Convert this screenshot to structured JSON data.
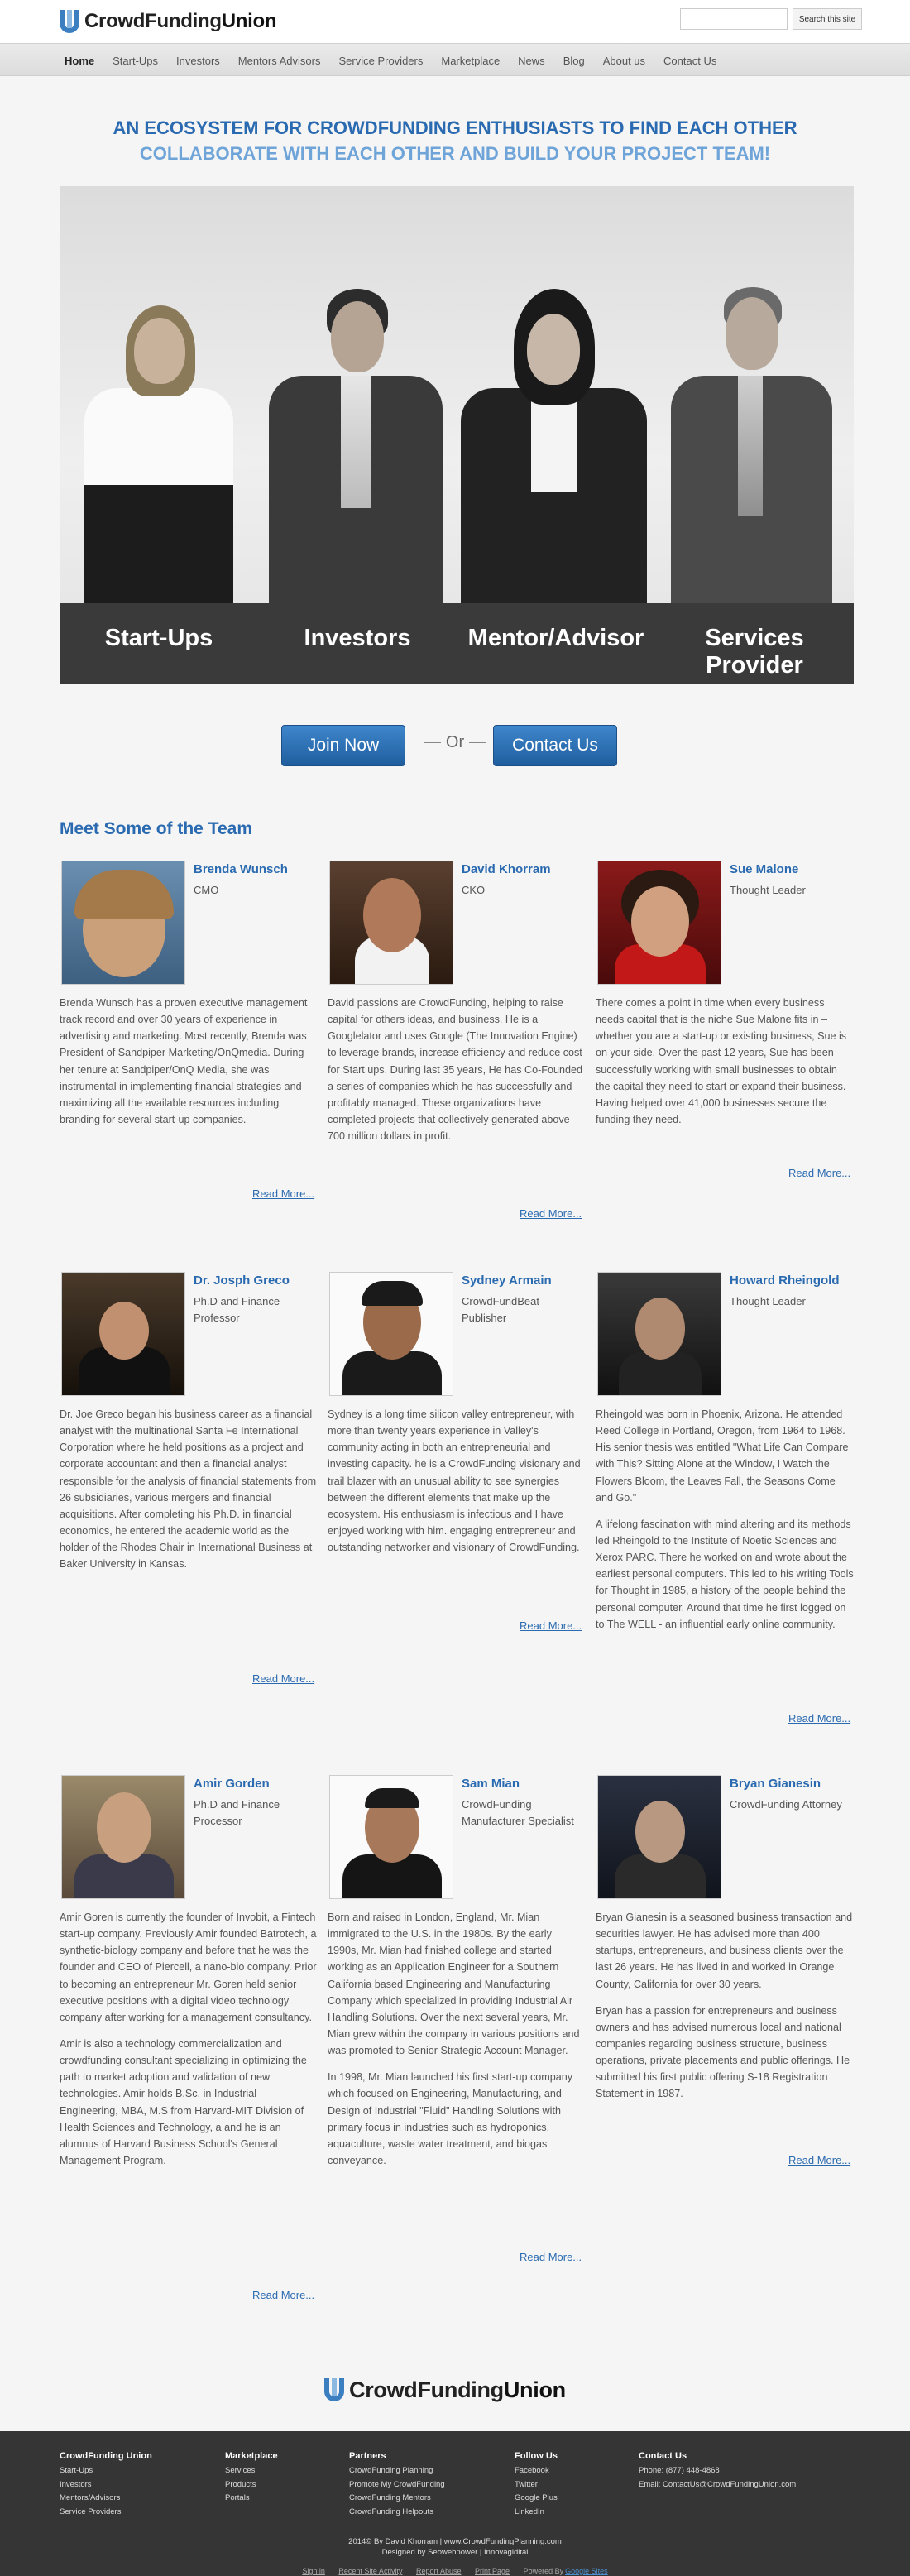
{
  "header": {
    "logo_prefix": "CrowdFunding",
    "logo_bold": "Union",
    "search_placeholder": "",
    "search_button": "Search this site"
  },
  "nav": [
    "Home",
    "Start-Ups",
    "Investors",
    "Mentors Advisors",
    "Service Providers",
    "Marketplace",
    "News",
    "Blog",
    "About us",
    "Contact Us"
  ],
  "hero": {
    "tagline1": "AN ECOSYSTEM FOR CROWDFUNDING ENTHUSIASTS TO FIND EACH OTHER",
    "tagline2": "COLLABORATE WITH EACH OTHER AND BUILD YOUR PROJECT TEAM!",
    "labels": [
      "Start-Ups",
      "Investors",
      "Mentor/Advisor",
      "Services Provider"
    ]
  },
  "cta": {
    "join": "Join Now",
    "or": "Or",
    "contact": "Contact Us"
  },
  "team": {
    "title": "Meet Some of the Team",
    "more_label": "Read More...",
    "members": [
      {
        "name": "Brenda Wunsch",
        "role": "CMO",
        "bio": [
          "Brenda Wunsch has a proven executive management track record and over 30 years of experience in advertising and marketing. Most recently, Brenda was President of Sandpiper Marketing/OnQmedia. During her tenure at Sandpiper/OnQ Media, she was instrumental in implementing financial strategies and maximizing all the available resources including branding for several start-up companies."
        ]
      },
      {
        "name": "David Khorram",
        "role": "CKO",
        "bio": [
          "David passions are CrowdFunding, helping to raise capital for others ideas, and business. He is a Googlelator and uses Google (The Innovation Engine) to leverage brands, increase efficiency and reduce cost for Start ups. During last 35 years, He has Co-Founded a series of companies which he has successfully and profitably managed. These organizations have completed projects that collectively generated above 700 million dollars in profit."
        ]
      },
      {
        "name": "Sue Malone",
        "role": "Thought Leader",
        "bio": [
          "There comes a point in time when every business needs capital that is the niche Sue Malone fits in – whether you are a start-up or existing business, Sue is on your side. Over the past 12 years, Sue has been successfully working with small businesses to obtain the capital they need to start or expand their business. Having helped over 41,000 businesses secure the funding they need."
        ]
      },
      {
        "name": "Dr. Josph Greco",
        "role": "Ph.D and Finance Professor",
        "bio": [
          "Dr. Joe Greco began his business career as a financial analyst with the multinational Santa Fe International Corporation where he held positions as a project and corporate accountant and then a financial analyst responsible for the analysis of financial statements from 26 subsidiaries, various mergers and financial acquisitions. After completing his Ph.D. in financial economics, he entered the academic world as the holder of the Rhodes Chair in International Business at Baker University in Kansas."
        ]
      },
      {
        "name": "Sydney Armain",
        "role": "CrowdFundBeat Publisher",
        "bio": [
          "Sydney is a long time silicon valley entrepreneur, with more than twenty years experience in Valley's community acting in both an entrepreneurial and investing capacity. he is a CrowdFunding visionary and trail blazer with an unusual ability to see synergies between the different elements that make up the ecosystem. His enthusiasm is infectious and I have enjoyed working with him. engaging entrepreneur and outstanding networker and visionary of CrowdFunding."
        ]
      },
      {
        "name": "Howard Rheingold",
        "role": "Thought Leader",
        "bio": [
          "Rheingold was born in Phoenix, Arizona. He attended Reed College in Portland, Oregon, from 1964 to 1968. His senior thesis was entitled \"What Life Can Compare with This? Sitting Alone at the Window, I Watch the Flowers Bloom, the Leaves Fall, the Seasons Come and Go.\"",
          "A lifelong fascination with mind altering and its methods led Rheingold to the Institute of Noetic Sciences and Xerox PARC. There he worked on and wrote about the earliest personal computers. This led to his writing Tools for Thought in 1985, a history of the people behind the personal computer. Around that time he first logged on to The WELL - an influential early online community."
        ]
      },
      {
        "name": "Amir Gorden",
        "role": "Ph.D and Finance Processor",
        "bio": [
          "Amir Goren is currently the founder of Invobit, a Fintech start-up company. Previously Amir founded Batrotech, a synthetic-biology company and before that he was the founder and CEO of Piercell, a nano-bio company. Prior to becoming an entrepreneur Mr. Goren held senior executive positions with a digital video technology company after working for a management consultancy.",
          "Amir is also a technology commercialization and crowdfunding consultant specializing in optimizing the path to market adoption and validation of new technologies. Amir holds B.Sc. in Industrial Engineering, MBA, M.S from Harvard-MIT Division of Health Sciences and Technology, a and he is an alumnus of Harvard Business School's General Management Program."
        ]
      },
      {
        "name": "Sam Mian",
        "role": "CrowdFunding Manufacturer Specialist",
        "bio": [
          "Born and raised in London, England, Mr. Mian immigrated to the U.S. in the 1980s. By the early 1990s, Mr. Mian had finished college and started working as an Application Engineer for a Southern California based Engineering and Manufacturing Company which specialized in providing Industrial Air Handling Solutions. Over the next several years, Mr. Mian grew within the company in various positions and was promoted to Senior Strategic Account Manager.",
          "In 1998, Mr. Mian launched his first start-up company which focused on Engineering, Manufacturing, and Design of Industrial \"Fluid\" Handling Solutions with primary focus in industries such as hydroponics, aquaculture, waste water treatment, and biogas conveyance."
        ]
      },
      {
        "name": "Bryan Gianesin",
        "role": "CrowdFunding Attorney",
        "bio": [
          "Bryan Gianesin is a seasoned business transaction and securities lawyer. He has advised more than 400 startups, entrepreneurs, and business clients over the last 26 years. He has lived in and worked in Orange County, California for over 30 years.",
          "Bryan has a passion for entrepreneurs and business owners and has advised numerous local and national companies regarding business structure, business operations, private placements and public offerings. He submitted his first public offering S-18 Registration Statement in 1987."
        ]
      }
    ]
  },
  "footer": {
    "columns": [
      {
        "title": "CrowdFunding Union",
        "links": [
          "Start-Ups",
          "Investors",
          "Mentors/Advisors",
          "Service Providers"
        ]
      },
      {
        "title": "Marketplace",
        "links": [
          "Services",
          "Products",
          "Portals"
        ]
      },
      {
        "title": "Partners",
        "links": [
          "CrowdFunding Planning",
          "Promote My CrowdFunding",
          "CrowdFunding Mentors",
          "CrowdFunding Helpouts"
        ]
      },
      {
        "title": "Follow Us",
        "links": [
          "Facebook",
          "Twitter",
          "Google Plus",
          "LinkedIn"
        ]
      },
      {
        "title": "Contact Us",
        "links": [
          "Phone: (877) 448-4868",
          "Email:  ContactUs@CrowdFundingUnion.com"
        ]
      }
    ],
    "credit1": "2014© By David Khorram | www.CrowdFundingPlanning.com",
    "credit2": "Designed by Seowebpower | Innovagidital",
    "bottom_links": [
      "Sign in",
      "Recent Site Activity",
      "Report Abuse",
      "Print Page",
      "Powered By"
    ],
    "bottom_accent": "Google Sites"
  }
}
